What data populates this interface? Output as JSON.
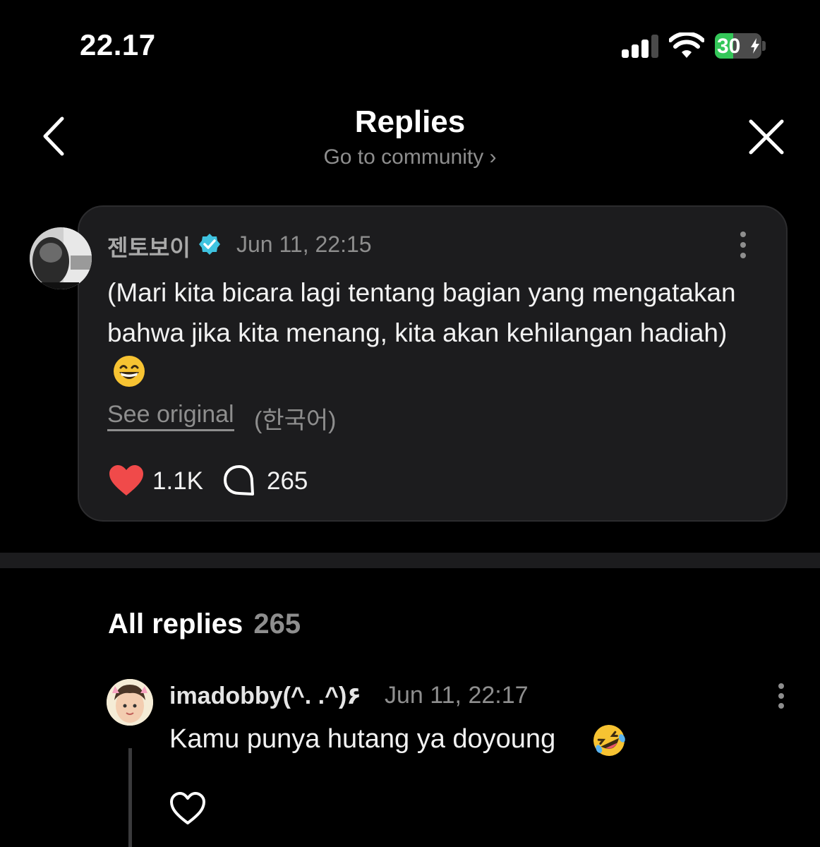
{
  "status_bar": {
    "time": "22.17",
    "battery": "30",
    "battery_level": 0.3,
    "signal_bars": 3
  },
  "header": {
    "title": "Replies",
    "subtitle": "Go to community ›"
  },
  "post": {
    "author": "젠토보이",
    "timestamp": "Jun 11, 22:15",
    "body": "(Mari kita bicara lagi tentang bagian yang mengatakan bahwa jika kita menang, kita akan kehilangan hadiah)",
    "see_original": "See original",
    "original_language": "(한국어)",
    "likes": "1.1K",
    "comments": "265"
  },
  "replies_section": {
    "heading": "All replies",
    "count": "265"
  },
  "replies": [
    {
      "author": "imadobby(^. .^)۶",
      "timestamp": "Jun 11, 22:17",
      "text": "Kamu punya hutang ya doyoung"
    }
  ],
  "colors": {
    "background": "#000000",
    "card": "#1c1c1e",
    "like_red": "#f04a4a",
    "verified_blue": "#3fc3e0",
    "battery_green": "#34c759",
    "muted_text": "#8e8e8e"
  }
}
